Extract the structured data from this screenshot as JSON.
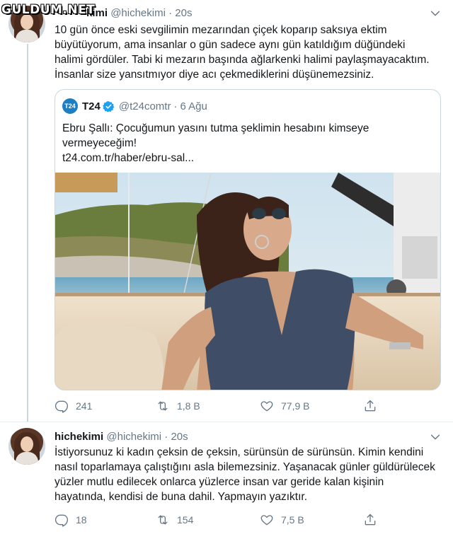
{
  "watermark": "GULDUM.NET",
  "tweets": [
    {
      "name": "hichekimi",
      "name_visible": "kimi",
      "handle": "@hichekimi",
      "separator": "·",
      "time": "20s",
      "text_lines": [
        "10 gün önce eski sevgilimin mezarından çiçek koparıp saksıya ektim",
        "büyütüyorum, ama insanlar o gün sadece aynı gün katıldığım düğündeki",
        "halimi gördüler. Tabi ki mezarın başında ağlarkenki halimi paylaşmayacaktım.",
        "İnsanlar size yansıtmıyor diye acı çekmediklerini düşünemezsiniz."
      ],
      "quote": {
        "avatar_text": "T24",
        "name": "T24",
        "handle": "@t24comtr",
        "separator": "·",
        "date": "6 Ağu",
        "text_lines": [
          "Ebru Şallı: Çocuğumun yasını tutma şeklimin hesabını kimseye",
          "vermeyeceğim!"
        ],
        "link": "t24.com.tr/haber/ebru-sal..."
      },
      "stats": {
        "replies": "241",
        "retweets": "1,8 B",
        "likes": "77,9 B"
      }
    },
    {
      "name": "hichekimi",
      "handle": "@hichekimi",
      "separator": "·",
      "time": "20s",
      "text_lines": [
        "İstiyorsunuz ki kadın çeksin de çeksin, sürünsün de sürünsün. Kimin kendini",
        "nasıl toparlamaya çalıştığını asla bilemezsiniz. Yaşanacak günler güldürülecek",
        "yüzler mutlu edilecek onlarca yüzlerce insan var geride kalan kişinin",
        "hayatında, kendisi de buna dahil. Yapmayın yazıktır."
      ],
      "stats": {
        "replies": "18",
        "retweets": "154",
        "likes": "7,5 B"
      }
    }
  ],
  "icons": {
    "reply": "reply-icon",
    "retweet": "retweet-icon",
    "like": "heart-icon",
    "share": "share-icon",
    "more": "chevron-down-icon",
    "verified": "verified-badge-icon"
  },
  "colors": {
    "text": "#14171a",
    "muted": "#657786",
    "border": "#ccd6dd",
    "verified": "#1da1f2"
  }
}
